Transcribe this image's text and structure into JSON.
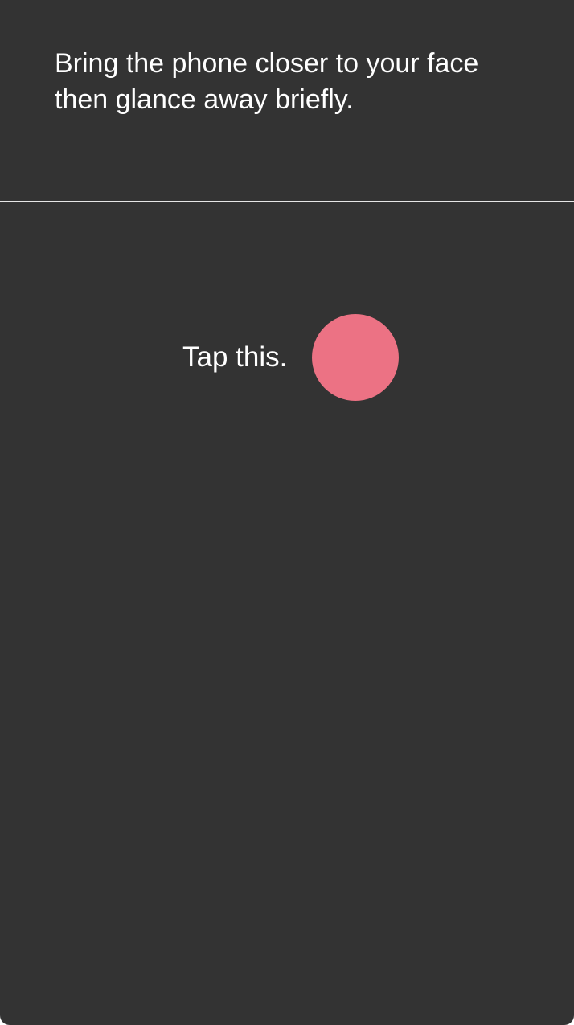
{
  "instruction": {
    "text": "Bring the phone closer to your face then glance away briefly."
  },
  "tap_prompt": {
    "label": "Tap this.",
    "target_color": "#ec7284"
  },
  "theme": {
    "background": "#333333",
    "text_color": "#ffffff",
    "divider_color": "#e6e6e6"
  }
}
